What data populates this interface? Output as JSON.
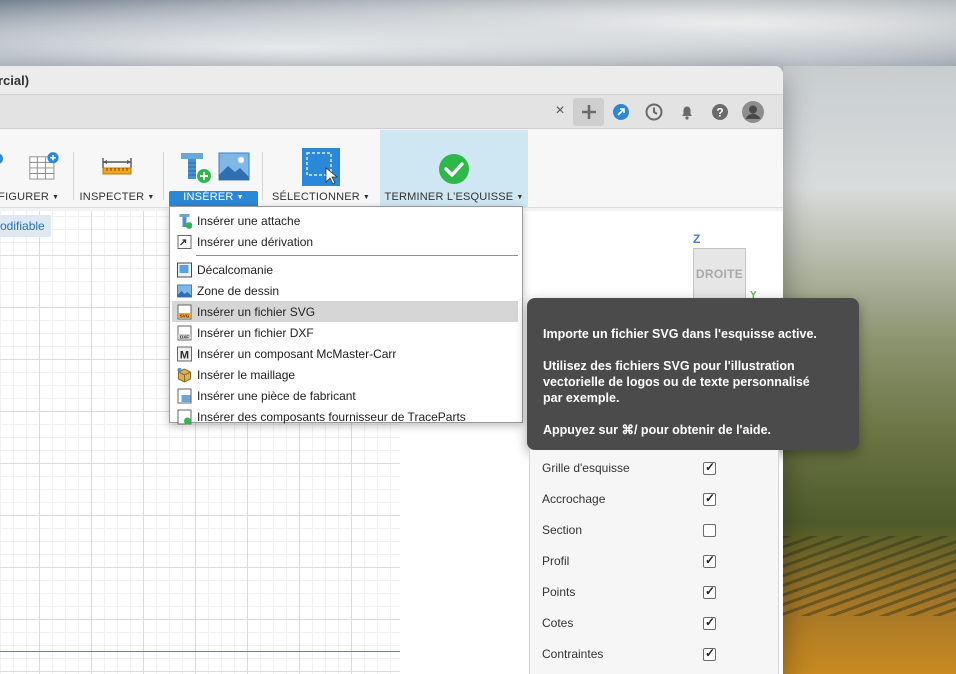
{
  "window": {
    "title": "rcial)"
  },
  "tabbar": {
    "close_glyph": "×",
    "icons": [
      "plus-icon",
      "extensions-icon",
      "job-status-icon",
      "notifications-icon",
      "help-icon",
      "profile-avatar"
    ]
  },
  "ribbon": {
    "configurer": "NFIGURER",
    "inspecter": "INSPECTER",
    "inserer": "INSÉRER",
    "selectionner": "SÉLECTIONNER",
    "terminer": "TERMINER L'ESQUISSE"
  },
  "canvas": {
    "mod_tag": "odifiable",
    "view_cube": {
      "face": "DROITE",
      "z_axis": "Z",
      "y_axis": "Y"
    }
  },
  "menu": {
    "group1": [
      "Insérer une attache",
      "Insérer une dérivation"
    ],
    "group2": [
      "Décalcomanie",
      "Zone de dessin",
      "Insérer un fichier SVG",
      "Insérer un fichier DXF",
      "Insérer un composant McMaster-Carr",
      "Insérer le maillage",
      "Insérer une pièce de fabricant",
      "Insérer des composants fournisseur de TraceParts"
    ],
    "highlighted": "Insérer un fichier SVG"
  },
  "tooltip": {
    "line1": "Importe un fichier SVG dans l'esquisse active.",
    "line2": "Utilisez des fichiers SVG pour l'illustration",
    "line3": "vectorielle de logos ou de texte personnalisé",
    "line4": "par exemple.",
    "line5": "Appuyez sur ⌘/ pour obtenir de l'aide."
  },
  "palette": {
    "rows": [
      {
        "label": "Grille d'esquisse",
        "checked": true
      },
      {
        "label": "Accrochage",
        "checked": true
      },
      {
        "label": "Section",
        "checked": false
      },
      {
        "label": "Profil",
        "checked": true
      },
      {
        "label": "Points",
        "checked": true
      },
      {
        "label": "Cotes",
        "checked": true
      },
      {
        "label": "Contraintes",
        "checked": true
      }
    ]
  },
  "colors": {
    "accent": "#2b88d8",
    "tooltip_bg": "#4b4b4b",
    "finish_green": "#2fb84a",
    "finish_bg": "#cfe6f3"
  }
}
